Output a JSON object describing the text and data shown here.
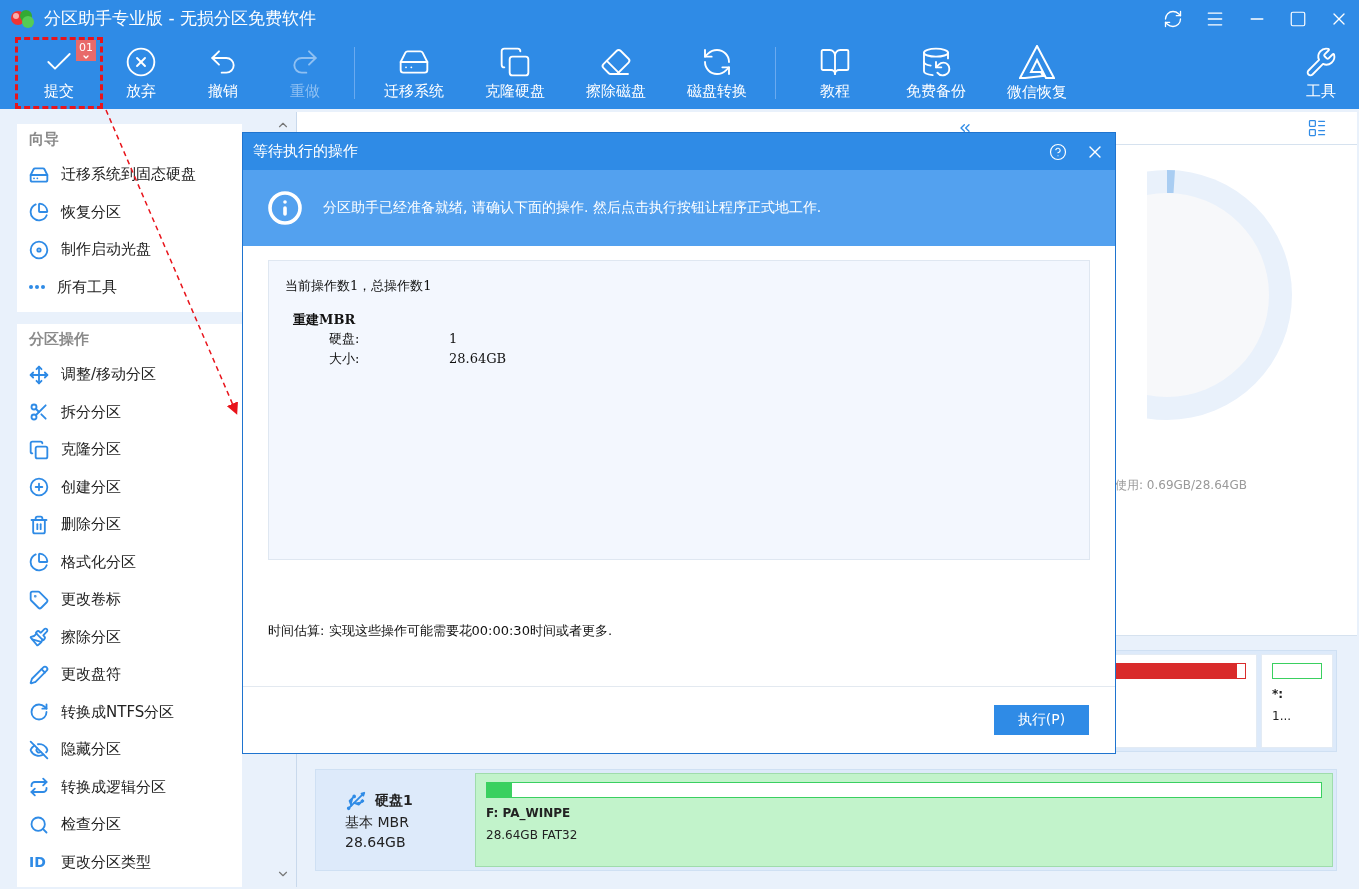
{
  "window": {
    "title": "分区助手专业版 - 无损分区免费软件"
  },
  "toolbar": {
    "groups": [
      [
        {
          "label": "提交",
          "disabled": false,
          "badge": "01",
          "highlighted": true
        },
        {
          "label": "放弃",
          "disabled": false
        },
        {
          "label": "撤销",
          "disabled": false
        },
        {
          "label": "重做",
          "disabled": true
        }
      ],
      [
        {
          "label": "迁移系统",
          "disabled": false
        },
        {
          "label": "克隆硬盘",
          "disabled": false
        },
        {
          "label": "擦除磁盘",
          "disabled": false
        },
        {
          "label": "磁盘转换",
          "disabled": false
        }
      ],
      [
        {
          "label": "教程",
          "disabled": false
        },
        {
          "label": "免费备份",
          "disabled": false
        },
        {
          "label": "微信恢复",
          "disabled": false
        }
      ]
    ],
    "tools": {
      "label": "工具",
      "disabled": false
    }
  },
  "sidebar": {
    "sections": [
      {
        "title": "向导",
        "items": [
          {
            "label": "迁移系统到固态硬盘"
          },
          {
            "label": "恢复分区"
          },
          {
            "label": "制作启动光盘"
          },
          {
            "label": "所有工具"
          }
        ]
      },
      {
        "title": "分区操作",
        "items": [
          {
            "label": "调整/移动分区"
          },
          {
            "label": "拆分分区"
          },
          {
            "label": "克隆分区"
          },
          {
            "label": "创建分区"
          },
          {
            "label": "删除分区"
          },
          {
            "label": "格式化分区"
          },
          {
            "label": "更改卷标"
          },
          {
            "label": "擦除分区"
          },
          {
            "label": "更改盘符"
          },
          {
            "label": "转换成NTFS分区"
          },
          {
            "label": "隐藏分区"
          },
          {
            "label": "转换成逻辑分区"
          },
          {
            "label": "检查分区"
          },
          {
            "label": "更改分区类型",
            "icon_text": "ID"
          }
        ]
      }
    ]
  },
  "usage": "使用: 0.69GB/28.64GB",
  "disks": [
    {
      "partitions": [
        {
          "kind": "wide",
          "level": 0.99,
          "color": "#d92b2b",
          "selected": false
        },
        {
          "kind": "narrow",
          "label": "*:",
          "info": "1...",
          "color": "#3ad060",
          "selected": false
        }
      ]
    },
    {
      "name": "硬盘1",
      "type": "基本 MBR",
      "size": "28.64GB",
      "partitions": [
        {
          "kind": "wide",
          "label": "F: PA_WINPE",
          "info": "28.64GB FAT32",
          "level": 0.03,
          "color": "#3ad060",
          "selected": true
        }
      ]
    }
  ],
  "dialog": {
    "title": "等待执行的操作",
    "info": "分区助手已经准备就绪, 请确认下面的操作. 然后点击执行按钮让程序正式地工作.",
    "summary": "当前操作数1，总操作数1",
    "operations": [
      {
        "name": "重建MBR",
        "details": [
          {
            "label": "硬盘:",
            "value": "1"
          },
          {
            "label": "大小:",
            "value": "28.64GB"
          }
        ]
      }
    ],
    "estimate": "时间估算: 实现这些操作可能需要花00:00:30时间或者更多.",
    "button": "执行(P)"
  }
}
